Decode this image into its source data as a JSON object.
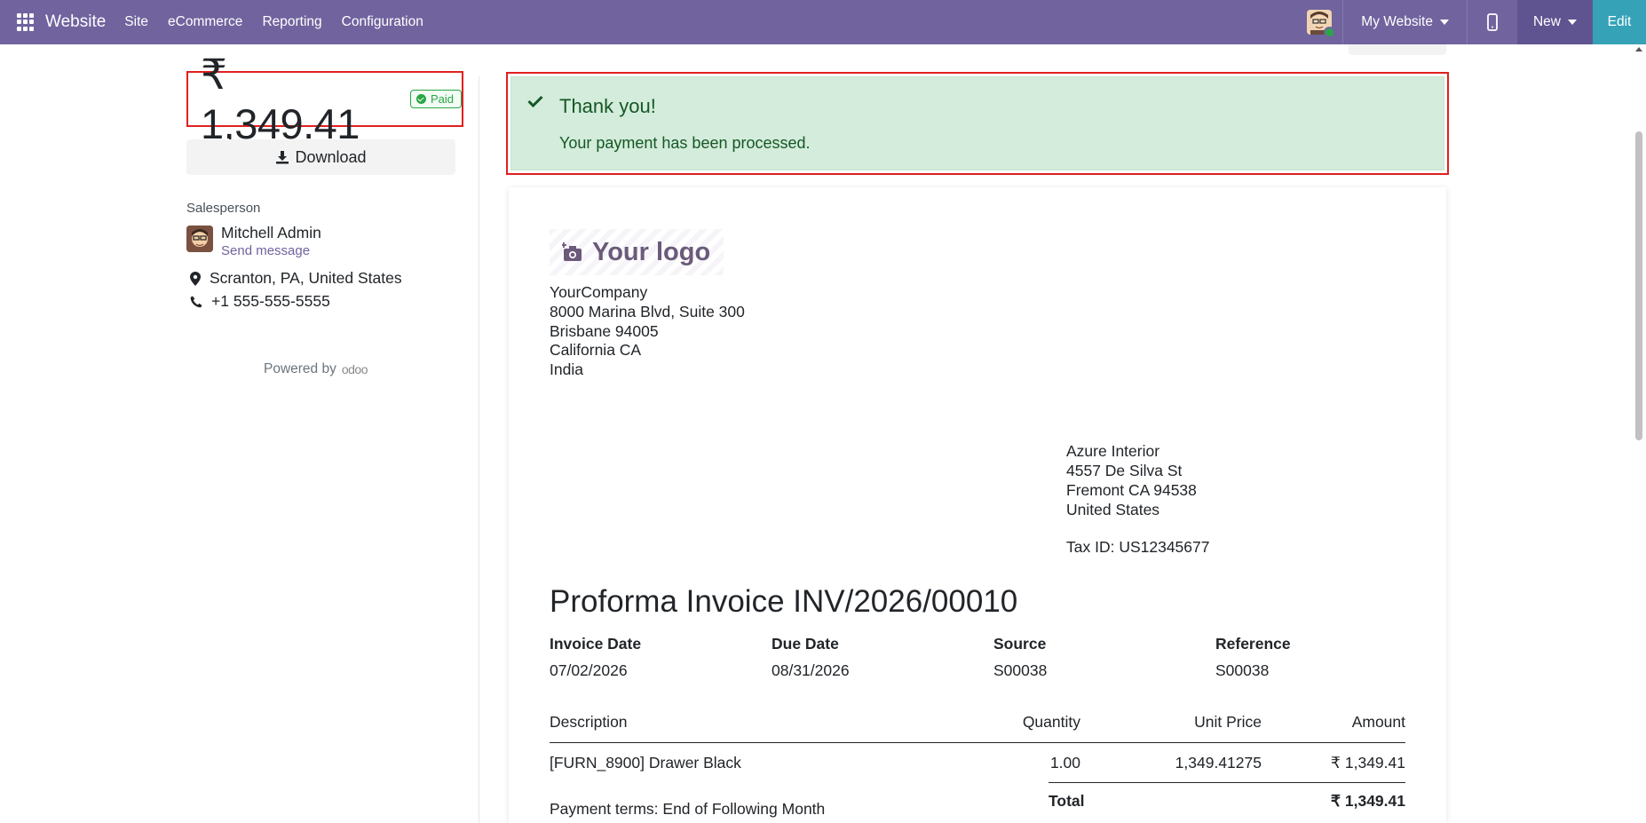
{
  "navbar": {
    "app_name": "Website",
    "menu": [
      "Site",
      "eCommerce",
      "Reporting",
      "Configuration"
    ],
    "website_selector": "My Website",
    "new_label": "New",
    "edit_label": "Edit",
    "color": "#71639e"
  },
  "sidebar": {
    "amount": "₹ 1,349.41",
    "status_badge": "Paid",
    "download_label": "Download",
    "salesperson_label": "Salesperson",
    "salesperson_name": "Mitchell Admin",
    "send_message": "Send message",
    "location": "Scranton, PA, United States",
    "phone": "+1 555-555-5555",
    "powered_by": "Powered by",
    "powered_brand": "odoo"
  },
  "alert": {
    "title": "Thank you!",
    "message": "Your payment has been processed."
  },
  "invoice": {
    "logo_text": "Your logo",
    "company_lines": [
      "YourCompany",
      "8000 Marina Blvd, Suite 300",
      "Brisbane 94005",
      "California CA",
      "India"
    ],
    "customer_lines": [
      "Azure Interior",
      "4557 De Silva St",
      "Fremont CA 94538",
      "United States"
    ],
    "tax_id": "Tax ID: US12345677",
    "title": "Proforma Invoice INV/2026/00010",
    "meta": [
      {
        "label": "Invoice Date",
        "value": "07/02/2026"
      },
      {
        "label": "Due Date",
        "value": "08/31/2026"
      },
      {
        "label": "Source",
        "value": "S00038"
      },
      {
        "label": "Reference",
        "value": "S00038"
      }
    ],
    "columns": {
      "description": "Description",
      "quantity": "Quantity",
      "unit_price": "Unit Price",
      "amount": "Amount"
    },
    "lines": [
      {
        "description": "[FURN_8900] Drawer Black",
        "quantity": "1.00",
        "unit_price": "1,349.41275",
        "amount": "₹ 1,349.41"
      }
    ],
    "total_label": "Total",
    "total_value": "₹ 1,349.41",
    "payment_terms": "Payment terms: End of Following Month"
  }
}
